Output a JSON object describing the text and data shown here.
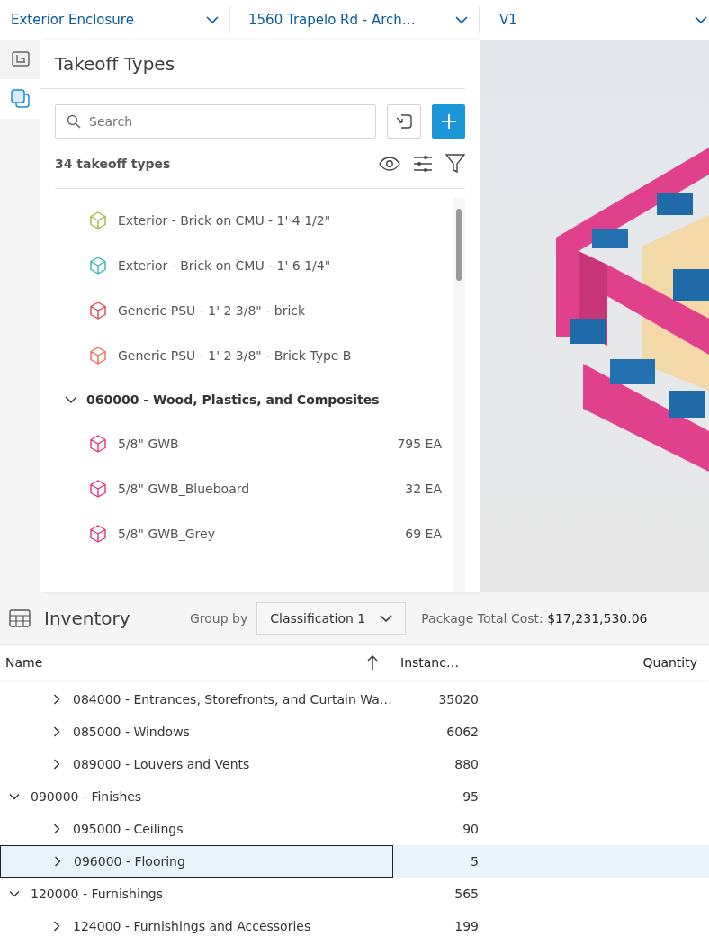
{
  "top_bar": {
    "selectors": [
      {
        "label": "Exterior Enclosure"
      },
      {
        "label": "1560 Trapelo Rd - Arch…"
      },
      {
        "label": "V1"
      }
    ]
  },
  "side_rail": {
    "tools": [
      {
        "kind": "sheets",
        "selected": false
      },
      {
        "kind": "models",
        "selected": true
      }
    ]
  },
  "takeoff_types": {
    "title": "Takeoff Types",
    "search": {
      "placeholder": "Search"
    },
    "count": "34 takeoff types",
    "continued_items": [
      {
        "label": "Exterior - Brick on CMU - 1' 4 1/2\"",
        "color": "#9bbb3c"
      },
      {
        "label": "Exterior - Brick on CMU - 1' 6 1/4\"",
        "color": "#2fb8a8"
      },
      {
        "label": "Generic PSU - 1' 2 3/8\" - brick",
        "color": "#e0434f"
      },
      {
        "label": "Generic PSU - 1' 2 3/8\" - Brick Type B",
        "color": "#ef6a4f"
      }
    ],
    "groups": [
      {
        "label": "060000 - Wood, Plastics, and Composites",
        "expanded": true,
        "children": [
          {
            "label": "5/8\" GWB",
            "quantity": "795 EA",
            "color": "#e0317a"
          },
          {
            "label": "5/8\" GWB_Blueboard",
            "quantity": "32 EA",
            "color": "#e0317a"
          },
          {
            "label": "5/8\" GWB_Grey",
            "quantity": "69 EA",
            "color": "#e0317a"
          }
        ]
      }
    ]
  },
  "inventory": {
    "title": "Inventory",
    "group_by_label": "Group by",
    "group_by_value": "Classification 1",
    "total_label": "Package Total Cost:",
    "total_value": "$17,231,530.06",
    "columns": [
      {
        "label": "Name",
        "sorted": true
      },
      {
        "label": "Instanc…",
        "sorted": false
      },
      {
        "label": "Quantity",
        "sorted": false
      }
    ],
    "continued_rows": [
      {
        "name": "084000 - Entrances, Storefronts, and Curtain Wa…",
        "instances": "35020",
        "expanded": false,
        "selected": false
      },
      {
        "name": "085000 - Windows",
        "instances": "6062",
        "expanded": false,
        "selected": false
      },
      {
        "name": "089000 - Louvers and Vents",
        "instances": "880",
        "expanded": false,
        "selected": false
      }
    ],
    "rows": [
      {
        "name": "090000 - Finishes",
        "instances": "95",
        "expanded": true,
        "selected": false,
        "children": [
          {
            "name": "095000 - Ceilings",
            "instances": "90",
            "expanded": false,
            "selected": false
          },
          {
            "name": "096000 - Flooring",
            "instances": "5",
            "expanded": false,
            "selected": true
          }
        ]
      },
      {
        "name": "120000 - Furnishings",
        "instances": "565",
        "expanded": true,
        "selected": false,
        "children": [
          {
            "name": "124000 - Furnishings and Accessories",
            "instances": "199",
            "expanded": false,
            "selected": false
          }
        ]
      }
    ]
  }
}
